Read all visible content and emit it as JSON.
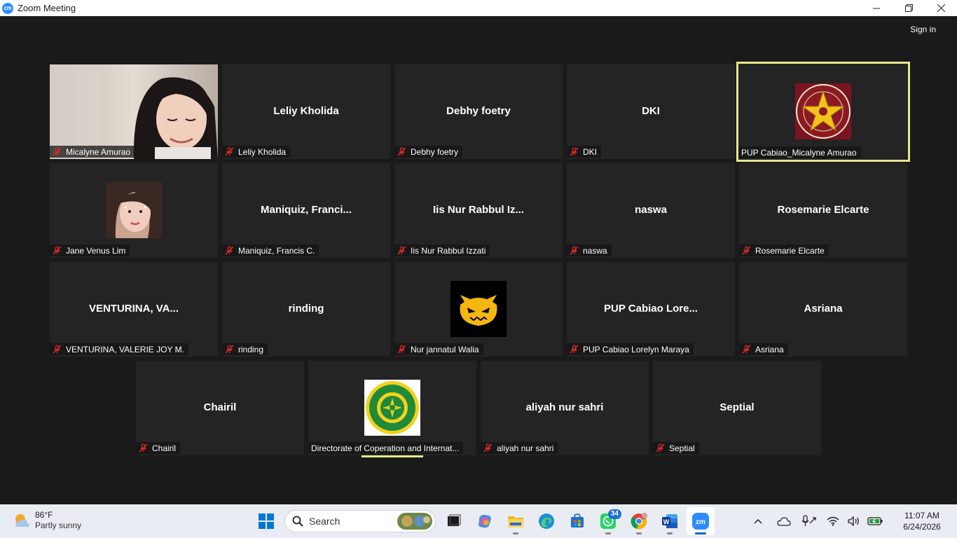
{
  "window": {
    "title": "Zoom Meeting",
    "app_icon_text": "zm"
  },
  "header": {
    "sign_in": "Sign in"
  },
  "participants": [
    {
      "display": "",
      "label": "Micalyne Amurao"
    },
    {
      "display": "Leliy Kholida",
      "label": "Leliy Kholida"
    },
    {
      "display": "Debhy foetry",
      "label": "Debhy foetry"
    },
    {
      "display": "DKI",
      "label": "DKI"
    },
    {
      "display": "",
      "label": "PUP Cabiao_Micalyne Amurao"
    },
    {
      "display": "",
      "label": "Jane Venus Lim"
    },
    {
      "display": "Maniquiz,  Franci...",
      "label": "Maniquiz, Francis C."
    },
    {
      "display": "Iis Nur Rabbul Iz...",
      "label": "Iis Nur Rabbul Izzati"
    },
    {
      "display": "naswa",
      "label": "naswa"
    },
    {
      "display": "Rosemarie Elcarte",
      "label": "Rosemarie Elcarte"
    },
    {
      "display": "VENTURINA,  VA...",
      "label": "VENTURINA, VALERIE JOY M."
    },
    {
      "display": "rinding",
      "label": "rinding"
    },
    {
      "display": "",
      "label": "Nur jannatul Walia"
    },
    {
      "display": "PUP Cabiao Lore...",
      "label": "PUP Cabiao Lorelyn Maraya"
    },
    {
      "display": "Asriana",
      "label": "Asriana"
    },
    {
      "display": "Chairil",
      "label": "Chairil"
    },
    {
      "display": "",
      "label": "Directorate of Coperation and Internat..."
    },
    {
      "display": "aliyah nur sahri",
      "label": "aliyah nur sahri"
    },
    {
      "display": "Septial",
      "label": "Septial"
    }
  ],
  "taskbar": {
    "weather_temp": "86°F",
    "weather_desc": "Partly sunny",
    "search_placeholder": "Search",
    "whatsapp_badge": "34",
    "word_letter": "W",
    "zoom_text": "zm",
    "time": "11:07 AM",
    "date": "6/24/2026"
  },
  "colors": {
    "meeting_bg": "#1a1a1a",
    "tile_bg": "#242424",
    "active_speaker": "#e6e88c",
    "mute_red": "#e02828",
    "zoom_blue": "#2d8cff"
  }
}
